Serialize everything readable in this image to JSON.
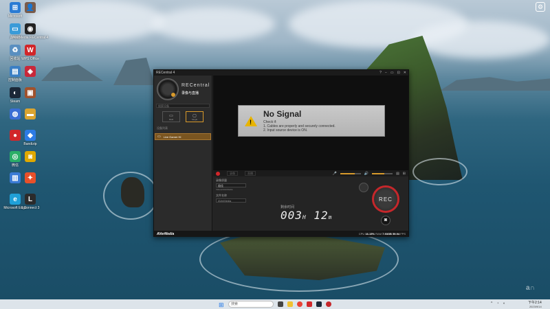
{
  "desktop": {
    "icons": [
      {
        "label": "Microsoft",
        "glyph": "⊞",
        "color": "#2a7bd4"
      },
      {
        "label": "",
        "glyph": "👤",
        "color": "#7a5b4a"
      },
      {
        "label": "此电脑",
        "glyph": "▭",
        "color": "#3a9bd8"
      },
      {
        "label": "AverMedia RECentral 4",
        "glyph": "◉",
        "color": "#222"
      },
      {
        "label": "回收站",
        "glyph": "♻",
        "color": "#5a8fc0"
      },
      {
        "label": "WPS Office",
        "glyph": "W",
        "color": "#d1262a"
      },
      {
        "label": "控制面板",
        "glyph": "▤",
        "color": "#3b7fc4"
      },
      {
        "label": "",
        "glyph": "◈",
        "color": "#c8283a"
      },
      {
        "label": "Steam",
        "glyph": "◐",
        "color": "#1b2838"
      },
      {
        "label": "",
        "glyph": "▣",
        "color": "#a0522d"
      },
      {
        "label": "",
        "glyph": "◍",
        "color": "#3b6fd4"
      },
      {
        "label": "",
        "glyph": "▬",
        "color": "#d9a430"
      },
      {
        "label": "",
        "glyph": "●",
        "color": "#d1262a"
      },
      {
        "label": "Bandizip",
        "glyph": "◆",
        "color": "#2c7be5"
      },
      {
        "label": "微信",
        "glyph": "◎",
        "color": "#2aae67"
      },
      {
        "label": "",
        "glyph": "◙",
        "color": "#e0a800"
      },
      {
        "label": "",
        "glyph": "▥",
        "color": "#3a7bd5"
      },
      {
        "label": "",
        "glyph": "✦",
        "color": "#e8502a"
      },
      {
        "label": "Microsoft Edge",
        "glyph": "e",
        "color": "#1fa0d8"
      },
      {
        "label": "L Connect 3",
        "glyph": "L",
        "color": "#2b2b2b"
      }
    ],
    "right_icon": {
      "label": "",
      "glyph": "⚙"
    }
  },
  "app": {
    "title": "RECentral 4",
    "window_controls": [
      "?",
      "−",
      "▭",
      "⊡",
      "✕"
    ],
    "logo_name": "RECentral",
    "mode_title": "录像与直播",
    "search_label": "搜索设备",
    "modes": [
      {
        "icon": "▭",
        "label": "Multi"
      },
      {
        "icon": "▢",
        "label": "Single"
      }
    ],
    "device_section_label": "设备列表",
    "device_name": "Live Gamer HI",
    "preview": {
      "title": "No Signal",
      "check_label": "Check if:",
      "lines": [
        "1. Cables are properly and securely connected.",
        "2. Input source device is ON."
      ]
    },
    "control_tabs": [
      "录像",
      "直播"
    ],
    "settings": {
      "quality_label": "录像质量",
      "quality_value": "极佳",
      "save_path": "Videos\\AVerMedia",
      "file_label": "文件名称",
      "file_value": "AVerMedia"
    },
    "timer_label": "剩余时间",
    "timer_hours": "003",
    "timer_h_unit": "H",
    "timer_minutes": "12",
    "timer_m_unit": "m",
    "rec_label": "REC",
    "volume_levels": [
      0.7,
      0.6
    ],
    "brand": "AVerMedia",
    "perf": {
      "cpu_label": "CPU",
      "cpu_value": "16.15%",
      "ram_label": "RAM",
      "ram_value": "7.93GB",
      "fps_value": "59.94",
      "fps_label": "FPS"
    }
  },
  "taskbar": {
    "search_placeholder": "搜索",
    "clock_time": "下午2:14",
    "clock_date": "2023/9/14"
  },
  "colors": {
    "accent": "#d99a2b",
    "record_red": "#c5272b",
    "device_bg": "#7a5520"
  }
}
